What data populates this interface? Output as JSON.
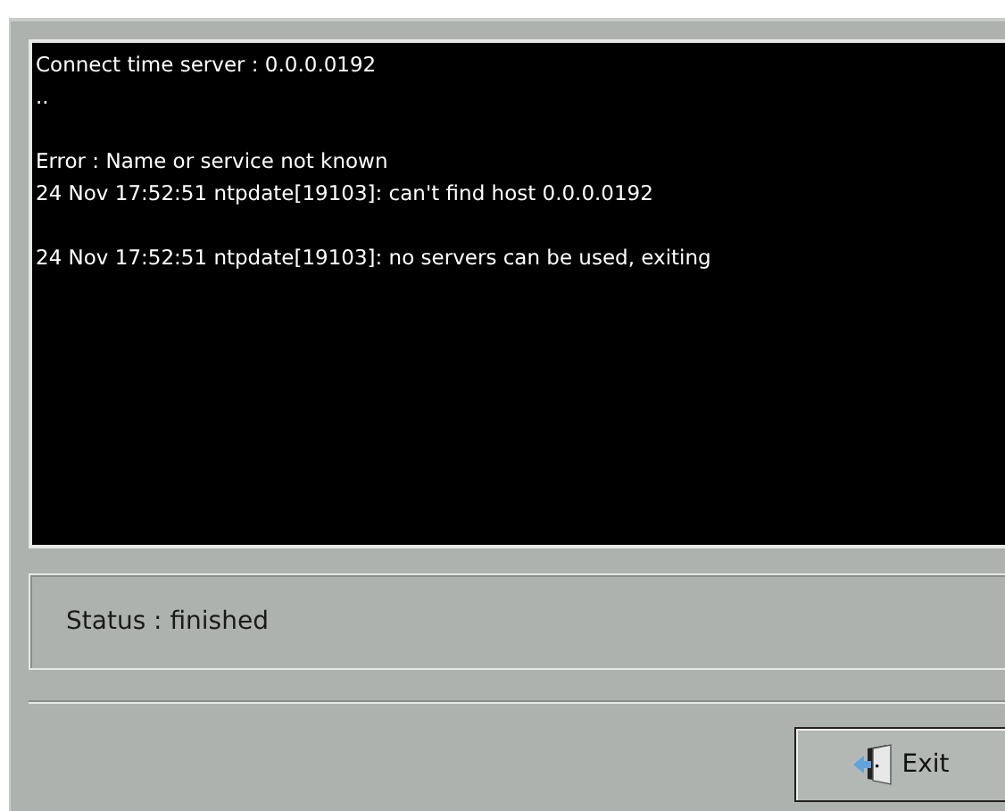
{
  "log": {
    "blocks": [
      [
        "Connect time server : 0.0.0.0192",
        ".."
      ],
      [
        "Error : Name or service not known",
        "24 Nov 17:52:51 ntpdate[19103]: can't find host 0.0.0.0192"
      ],
      [
        "24 Nov 17:52:51 ntpdate[19103]: no servers can be used, exiting"
      ]
    ]
  },
  "status": "Status : finished",
  "buttons": [
    {
      "label": "Exit",
      "kind": "exit"
    }
  ]
}
